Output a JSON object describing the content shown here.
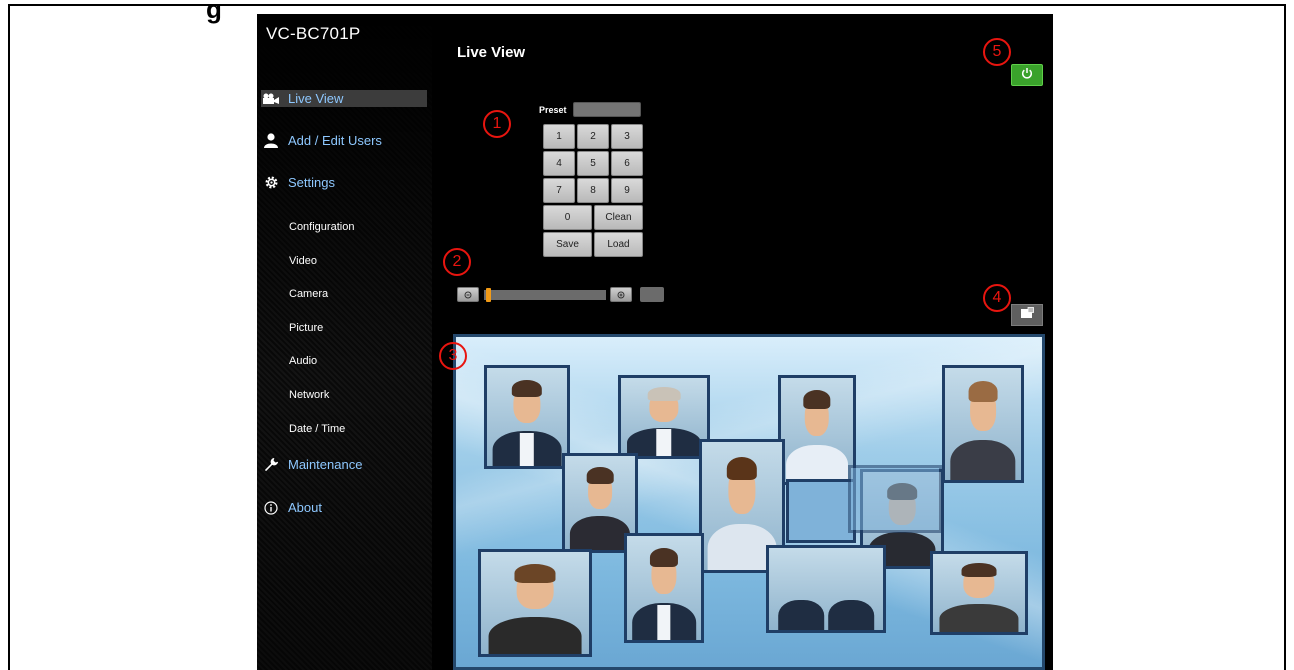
{
  "doc": {
    "top_fragment": "g"
  },
  "app": {
    "brand": "VC-BC701P",
    "page_title": "Live View"
  },
  "sidebar": {
    "items": [
      {
        "label": "Live View",
        "icon": "video-camera-icon",
        "active": true
      },
      {
        "label": "Add / Edit Users",
        "icon": "user-icon",
        "active": false
      },
      {
        "label": "Settings",
        "icon": "gear-icon",
        "active": false
      },
      {
        "label": "Maintenance",
        "icon": "wrench-icon",
        "active": false
      },
      {
        "label": "About",
        "icon": "info-icon",
        "active": false
      }
    ],
    "settings_sub": [
      "Configuration",
      "Video",
      "Camera",
      "Picture",
      "Audio",
      "Network",
      "Date / Time"
    ]
  },
  "preset": {
    "label": "Preset",
    "value": "",
    "keys": [
      "1",
      "2",
      "3",
      "4",
      "5",
      "6",
      "7",
      "8",
      "9"
    ],
    "zero": "0",
    "clean": "Clean",
    "save": "Save",
    "load": "Load"
  },
  "zoom": {
    "level": 0.02,
    "value": ""
  },
  "buttons": {
    "power_icon": "power-icon",
    "fullscreen_icon": "fullscreen-icon"
  },
  "colors": {
    "accent_active_bg": "#3c3c3c",
    "link": "#8ec8ff",
    "power": "#3aa22b",
    "marker": "#e8150f"
  },
  "markers": [
    "1",
    "2",
    "3",
    "4",
    "5"
  ]
}
